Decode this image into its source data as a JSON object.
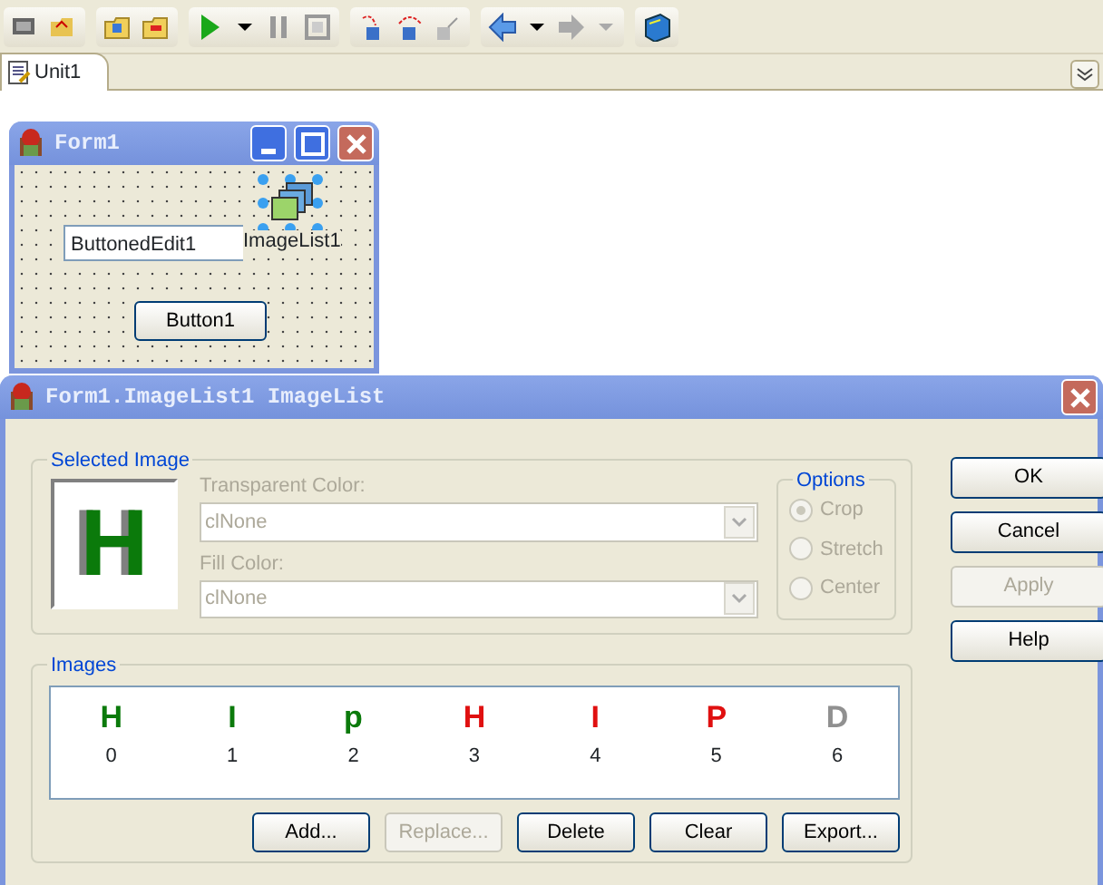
{
  "editor_tabs": [
    {
      "label": "Unit1",
      "selected": true
    }
  ],
  "form_window": {
    "title": "Form1",
    "edit_text": "ButtonedEdit1",
    "imagelist_caption": "ImageList1",
    "imagelist_selected": true,
    "button_text": "Button1"
  },
  "dialog": {
    "title": "Form1.ImageList1 ImageList",
    "selected_image": {
      "group_label": "Selected Image",
      "preview_glyph": "H",
      "fields": [
        {
          "label": "Transparent Color:",
          "value": "clNone",
          "disabled": true
        },
        {
          "label": "Fill Color:",
          "value": "clNone",
          "disabled": true
        }
      ],
      "options": {
        "label": "Options",
        "items": [
          {
            "label": "Crop",
            "selected": true,
            "disabled": true
          },
          {
            "label": "Stretch",
            "selected": false,
            "disabled": true
          },
          {
            "label": "Center",
            "selected": false,
            "disabled": true
          }
        ]
      }
    },
    "side_buttons": [
      {
        "label": "OK",
        "disabled": false
      },
      {
        "label": "Cancel",
        "disabled": false
      },
      {
        "label": "Apply",
        "disabled": true
      },
      {
        "label": "Help",
        "disabled": false
      }
    ],
    "images": {
      "group_label": "Images",
      "items": [
        {
          "glyph": "H",
          "color": "#0b7a0b",
          "label": "0"
        },
        {
          "glyph": "I",
          "color": "#0b7a0b",
          "label": "1"
        },
        {
          "glyph": "p",
          "color": "#0b7a0b",
          "label": "2"
        },
        {
          "glyph": "H",
          "color": "#e01010",
          "label": "3"
        },
        {
          "glyph": "I",
          "color": "#e01010",
          "label": "4"
        },
        {
          "glyph": "P",
          "color": "#e01010",
          "label": "5"
        },
        {
          "glyph": "D",
          "color": "#909090",
          "label": "6"
        }
      ],
      "buttons": [
        {
          "label": "Add...",
          "disabled": false
        },
        {
          "label": "Replace...",
          "disabled": true
        },
        {
          "label": "Delete",
          "disabled": false
        },
        {
          "label": "Clear",
          "disabled": false
        },
        {
          "label": "Export...",
          "disabled": false
        }
      ]
    }
  }
}
